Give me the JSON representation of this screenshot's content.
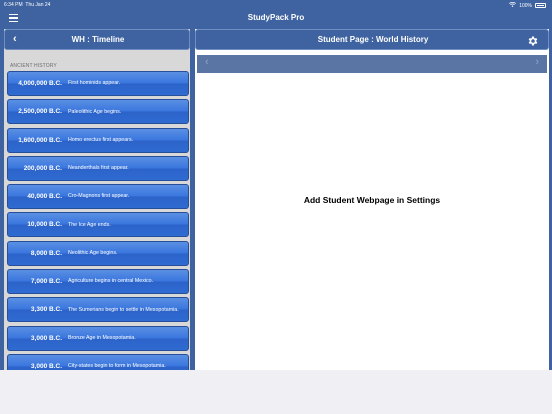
{
  "status_bar": {
    "time": "6:34 PM",
    "date": "Thu Jan 24",
    "battery": "100%"
  },
  "app": {
    "title": "StudyPack Pro",
    "menu_icon": "hamburger-icon"
  },
  "left_panel": {
    "title": "WH : Timeline",
    "back_icon": "chevron-left-icon",
    "section": "ANCIENT HISTORY",
    "items": [
      {
        "date": "4,000,000 B.C.",
        "event": "First hominids appear."
      },
      {
        "date": "2,500,000 B.C.",
        "event": "Paleolithic Age begins."
      },
      {
        "date": "1,600,000 B.C.",
        "event": "Homo erectus first appears."
      },
      {
        "date": "200,000 B.C.",
        "event": "Neanderthals first appear."
      },
      {
        "date": "40,000 B.C.",
        "event": "Cro-Magnons first appear."
      },
      {
        "date": "10,000 B.C.",
        "event": "The Ice Age ends."
      },
      {
        "date": "8,000 B.C.",
        "event": "Neolithic Age begins."
      },
      {
        "date": "7,000 B.C.",
        "event": "Agriculture begins in central Mexico."
      },
      {
        "date": "3,300 B.C.",
        "event": "The Sumerians begin to settle in Mesopotamia."
      },
      {
        "date": "3,000 B.C.",
        "event": "Bronze Age in Mesopotamia."
      },
      {
        "date": "3,000 B.C.",
        "event": "City-states begin to form in Mesopotamia."
      }
    ]
  },
  "right_panel": {
    "title": "Student Page : World History",
    "settings_icon": "gear-icon",
    "nav_back_icon": "chevron-left-icon",
    "nav_forward_icon": "chevron-right-icon",
    "message": "Add Student Webpage in Settings"
  },
  "colors": {
    "accent": "#3f63a0",
    "row_blue": "#3a76de",
    "web_nav": "#5a75a3"
  }
}
